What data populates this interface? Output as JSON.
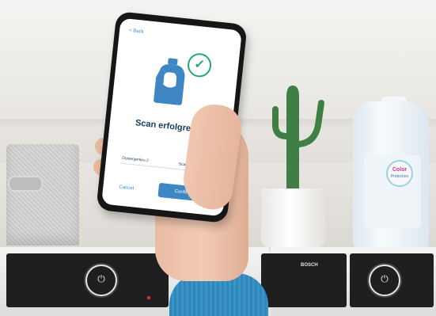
{
  "phone_screen": {
    "back_label": "< Back",
    "title": "Scan erfolgreich!",
    "option_left": "Dosiergerties 2",
    "option_right": "Scan again",
    "cancel_label": "Cancel",
    "confirm_label": "Confirm",
    "colors": {
      "accent": "#3f87c4",
      "success": "#27a96a",
      "title": "#163a5d"
    },
    "icons": [
      "detergent-bottle-icon",
      "checkmark-circle-icon"
    ]
  },
  "bottle": {
    "label_line1": "Color",
    "label_line2": "Protection"
  },
  "machine_right": {
    "brand": "BOSCH"
  }
}
